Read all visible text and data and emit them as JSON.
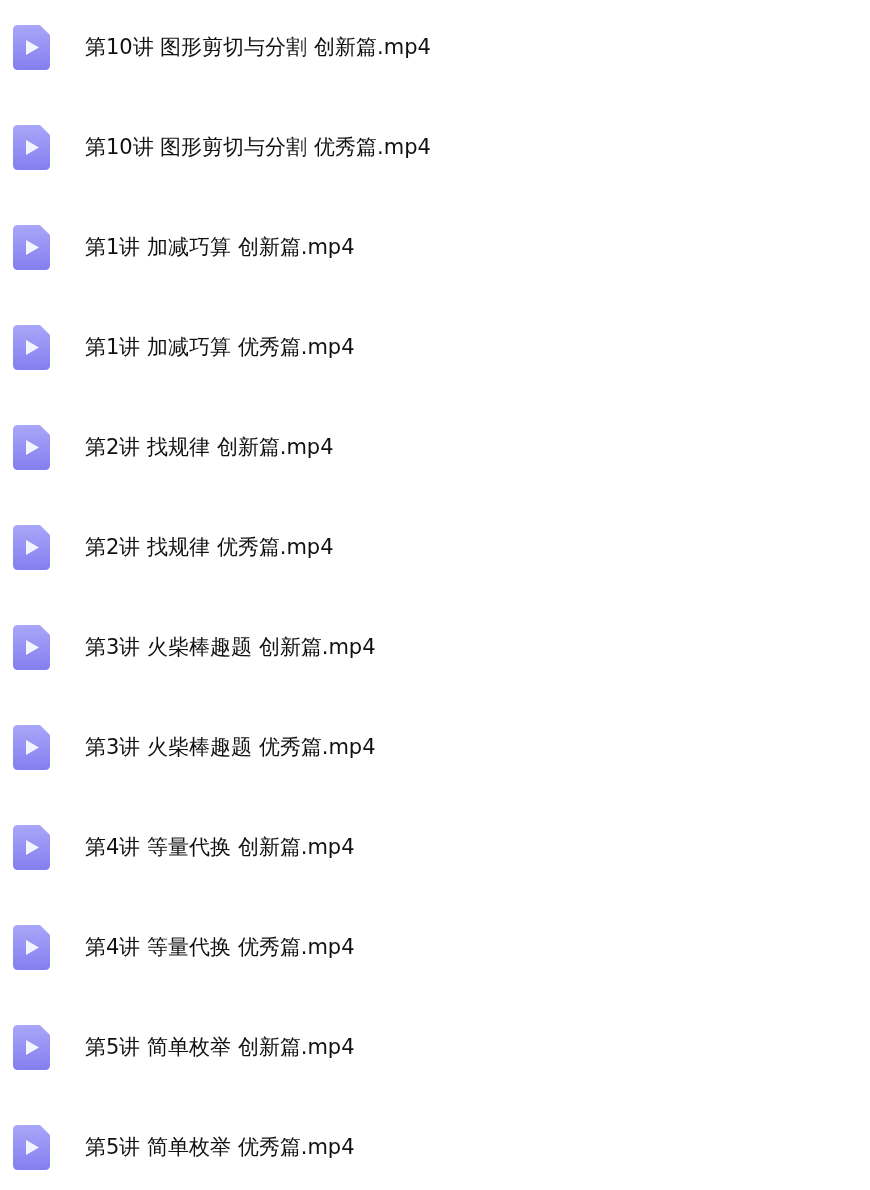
{
  "files": [
    {
      "name": "第10讲 图形剪切与分割 创新篇.mp4"
    },
    {
      "name": "第10讲 图形剪切与分割 优秀篇.mp4"
    },
    {
      "name": "第1讲 加减巧算 创新篇.mp4"
    },
    {
      "name": "第1讲 加减巧算 优秀篇.mp4"
    },
    {
      "name": "第2讲 找规律 创新篇.mp4"
    },
    {
      "name": "第2讲 找规律 优秀篇.mp4"
    },
    {
      "name": "第3讲 火柴棒趣题 创新篇.mp4"
    },
    {
      "name": "第3讲 火柴棒趣题 优秀篇.mp4"
    },
    {
      "name": "第4讲 等量代换 创新篇.mp4"
    },
    {
      "name": "第4讲 等量代换 优秀篇.mp4"
    },
    {
      "name": "第5讲 简单枚举 创新篇.mp4"
    },
    {
      "name": "第5讲 简单枚举 优秀篇.mp4"
    }
  ]
}
